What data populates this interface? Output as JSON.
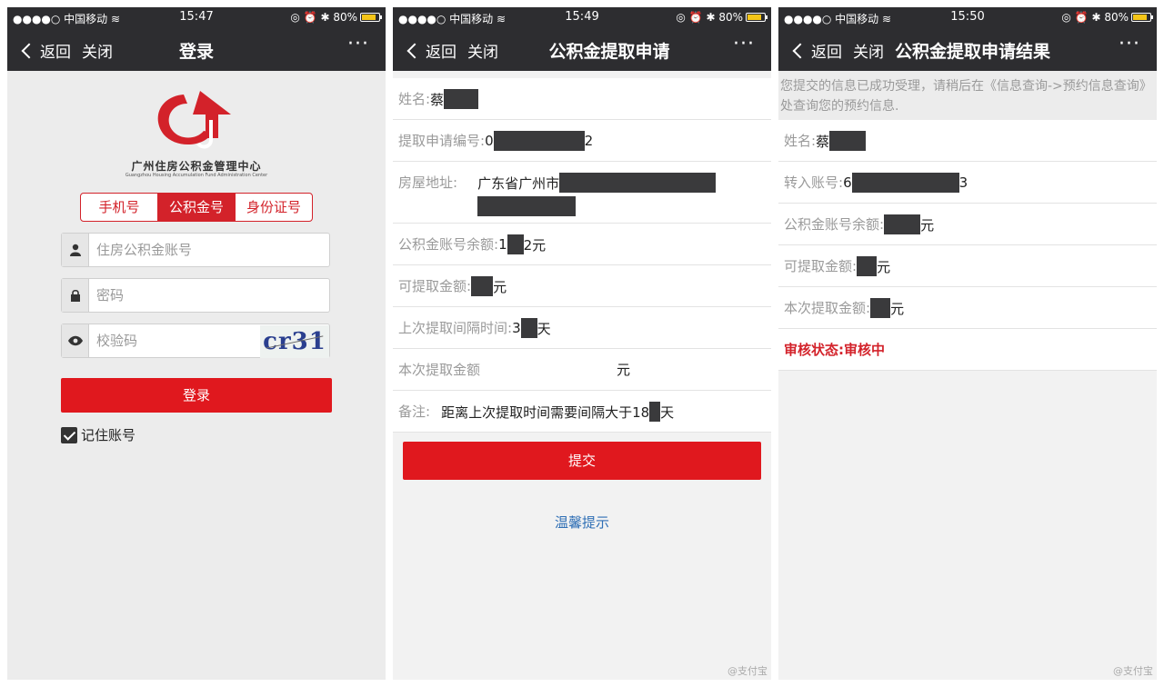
{
  "status": {
    "carrier": "●●●●○ 中国移动",
    "battery": "80%",
    "icons": [
      "wifi-icon",
      "location-icon",
      "alarm-icon",
      "bluetooth-icon",
      "battery-icon"
    ]
  },
  "nav": {
    "back": "返回",
    "close": "关闭",
    "more": "···"
  },
  "login": {
    "time": "15:47",
    "title": "登录",
    "org_cn": "广州住房公积金管理中心",
    "org_en": "Guangzhou Housing Accumulation Fund Administration Center",
    "tabs": [
      "手机号",
      "公积金号",
      "身份证号"
    ],
    "active_tab": 1,
    "account_placeholder": "住房公积金账号",
    "password_placeholder": "密码",
    "captcha_placeholder": "校验码",
    "captcha_text": "cr31",
    "login_button": "登录",
    "remember": "记住账号",
    "accent": "#e0181e"
  },
  "apply": {
    "time": "15:49",
    "title": "公积金提取申请",
    "name_label": "姓名:",
    "name_value": "蔡",
    "app_no_label": "提取申请编号:",
    "app_no_prefix": "0",
    "app_no_suffix": "2",
    "address_label": "房屋地址:",
    "address_value": "广东省广州市",
    "balance_label": "公积金账号余额:",
    "balance_prefix": "1",
    "balance_suffix": "2元",
    "withdrawable_label": "可提取金额:",
    "withdrawable_suffix": "元",
    "interval_label": "上次提取间隔时间:",
    "interval_prefix": "3",
    "interval_suffix": "天",
    "amount_label": "本次提取金额",
    "amount_suffix": "元",
    "remark_label": "备注:",
    "remark_value": "距离上次提取时间需要间隔大于18",
    "remark_suffix": "天",
    "submit_button": "提交",
    "tip_link": "温馨提示"
  },
  "result": {
    "time": "15:50",
    "title": "公积金提取申请结果",
    "notice": "您提交的信息已成功受理，请稍后在《信息查询->预约信息查询》处查询您的预约信息.",
    "name_label": "姓名:",
    "name_value": "蔡",
    "account_label": "转入账号:",
    "account_prefix": "6",
    "account_suffix": "3",
    "balance_label": "公积金账号余额:",
    "balance_suffix": "元",
    "withdrawable_label": "可提取金额:",
    "withdrawable_suffix": "元",
    "current_label": "本次提取金额:",
    "current_suffix": "元",
    "status_label": "审核状态:",
    "status_value": "审核中"
  },
  "watermark": "@支付宝"
}
